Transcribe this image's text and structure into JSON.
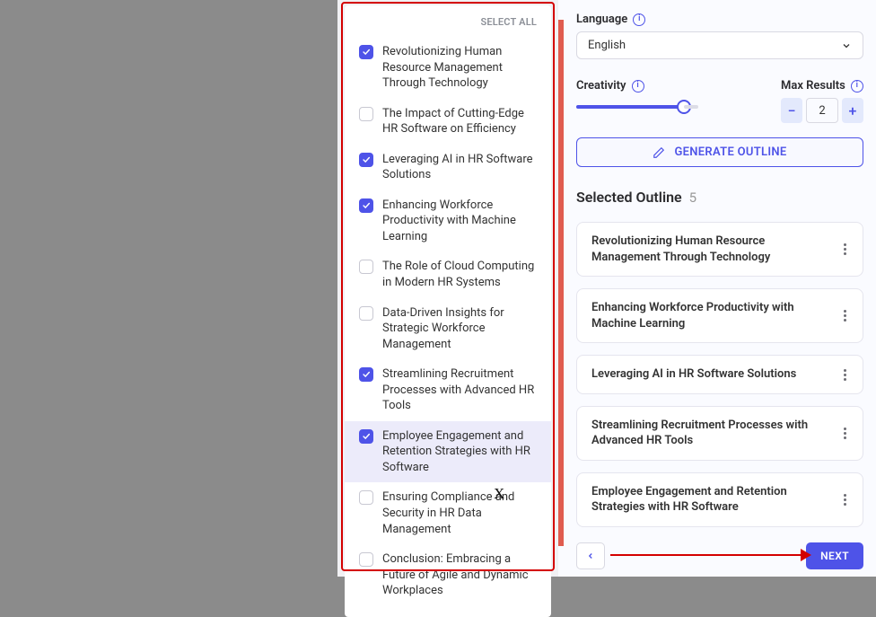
{
  "middle": {
    "select_all": "SELECT ALL",
    "options": [
      {
        "label": "Revolutionizing Human Resource Management Through Technology",
        "checked": true
      },
      {
        "label": "The Impact of Cutting-Edge HR Software on Efficiency",
        "checked": false
      },
      {
        "label": "Leveraging AI in HR Software Solutions",
        "checked": true
      },
      {
        "label": "Enhancing Workforce Productivity with Machine Learning",
        "checked": true
      },
      {
        "label": "The Role of Cloud Computing in Modern HR Systems",
        "checked": false
      },
      {
        "label": "Data-Driven Insights for Strategic Workforce Management",
        "checked": false
      },
      {
        "label": "Streamlining Recruitment Processes with Advanced HR Tools",
        "checked": true
      },
      {
        "label": "Employee Engagement and Retention Strategies with HR Software",
        "checked": true,
        "highlighted": true
      },
      {
        "label": "Ensuring Compliance and Security in HR Data Management",
        "checked": false
      },
      {
        "label": "Conclusion: Embracing a Future of Agile and Dynamic Workplaces",
        "checked": false
      }
    ]
  },
  "right": {
    "language_label": "Language",
    "language_value": "English",
    "creativity_label": "Creativity",
    "max_results_label": "Max Results",
    "max_results_value": "2",
    "generate_label": "GENERATE OUTLINE",
    "selected_outline_label": "Selected Outline",
    "selected_count": "5",
    "selected_items": [
      "Revolutionizing Human Resource Management Through Technology",
      "Enhancing Workforce Productivity with Machine Learning",
      "Leveraging AI in HR Software Solutions",
      "Streamlining Recruitment Processes with Advanced HR Tools",
      "Employee Engagement and Retention Strategies with HR Software"
    ],
    "next_label": "NEXT"
  },
  "annotation": {
    "x": "X"
  }
}
